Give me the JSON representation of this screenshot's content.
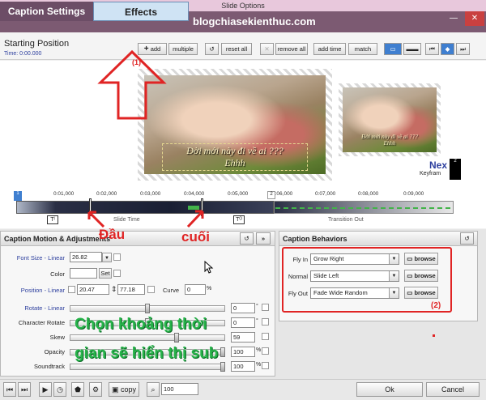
{
  "window": {
    "title": "Slide Options",
    "minimize": "—",
    "close": "✕"
  },
  "tabs": [
    {
      "label": "Caption Settings"
    },
    {
      "label": "Effects"
    }
  ],
  "watermark": "blogchiasekienthuc.com",
  "toolbar": {
    "position_label": "Starting Position",
    "time": "Time: 0:00.000",
    "add": "add",
    "multiple": "multiple",
    "reset_all": "reset all",
    "remove_all": "remove all",
    "add_time": "add time",
    "match": "match"
  },
  "preview": {
    "caption_line1": "Đời mới này đi về ai ???",
    "caption_line2": "Ehhh",
    "next_label": "Nex",
    "keyframe_label": "Keyfram",
    "keyframe_number": "2"
  },
  "timeline": {
    "ticks": [
      "0:01,000",
      "0:02,000",
      "0:03,000",
      "0:04,000",
      "0:05,000",
      "0:06,000",
      "0:07,000",
      "0:08,000",
      "0:09,000"
    ],
    "start_marker": "1",
    "end_marker": "2",
    "slide_time": "Slide Time",
    "transition_out": "Transition Out"
  },
  "motion": {
    "title": "Caption Motion & Adjustments",
    "font_size_label": "Font Size - Linear",
    "font_size_value": "26.82",
    "color_label": "Color",
    "set_label": "Set",
    "position_label": "Position - Linear",
    "pos_x": "20.47",
    "pos_y": "77.18",
    "curve_label": "Curve",
    "curve_value": "0",
    "rotate_label": "Rotate - Linear",
    "rotate_value": "0",
    "char_rotate_label": "Character Rotate",
    "char_rotate_value": "0",
    "skew_label": "Skew",
    "skew_value": "59",
    "opacity_label": "Opacity",
    "opacity_value": "100",
    "soundtrack_label": "Soundtrack",
    "soundtrack_value": "100",
    "pct": "%",
    "deg": "°"
  },
  "behaviors": {
    "title": "Caption Behaviors",
    "fly_in_label": "Fly In",
    "fly_in_value": "Grow Right",
    "normal_label": "Normal",
    "normal_value": "Slide Left",
    "fly_out_label": "Fly Out",
    "fly_out_value": "Fade Wide Random",
    "browse": "browse"
  },
  "annotations": {
    "num1": "(1)",
    "num2": "(2)",
    "start": "Đầu",
    "end": "cuối",
    "instruction_line1": "Chọn khoảng thời",
    "instruction_line2": "gian sẽ hiển thị sub"
  },
  "bottom": {
    "copy": "copy",
    "zoom": "100",
    "ok": "Ok",
    "cancel": "Cancel"
  },
  "colors": {
    "accent": "#7c5a72",
    "annotation_red": "#e02424",
    "annotation_green": "#27b34a"
  }
}
